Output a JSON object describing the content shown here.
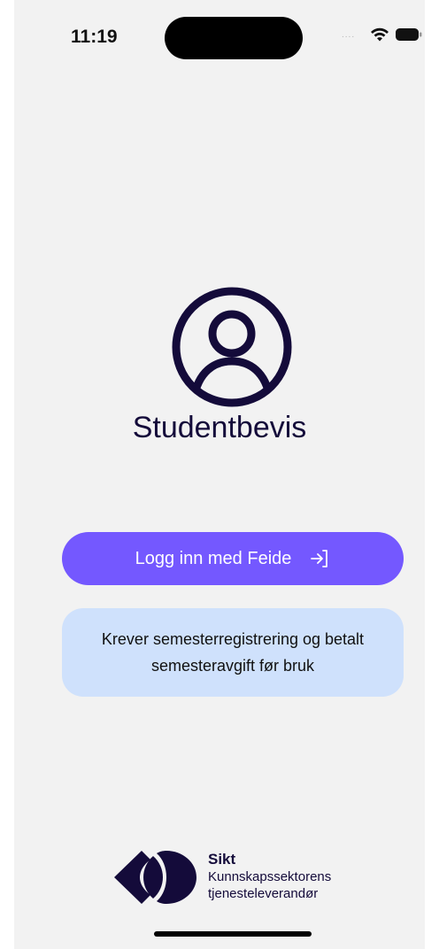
{
  "status_bar": {
    "time": "11:19",
    "signal": "....",
    "icons": [
      "wifi-icon",
      "battery-icon"
    ]
  },
  "main": {
    "icon": "profile-icon",
    "title": "Studentbevis",
    "login_button": {
      "label": "Logg inn med Feide",
      "icon": "login-arrow-icon"
    },
    "info_text": "Krever semesterregistrering og betalt semesteravgift før bruk"
  },
  "footer": {
    "logo_icon": "sikt-logo-icon",
    "brand_name": "Sikt",
    "tagline": "Kunnskapssektorens tjenesteleverandør"
  },
  "colors": {
    "background": "#f2f2f2",
    "accent": "#7458ff",
    "info_bg": "#cfe1fc",
    "navy": "#140b3a"
  }
}
